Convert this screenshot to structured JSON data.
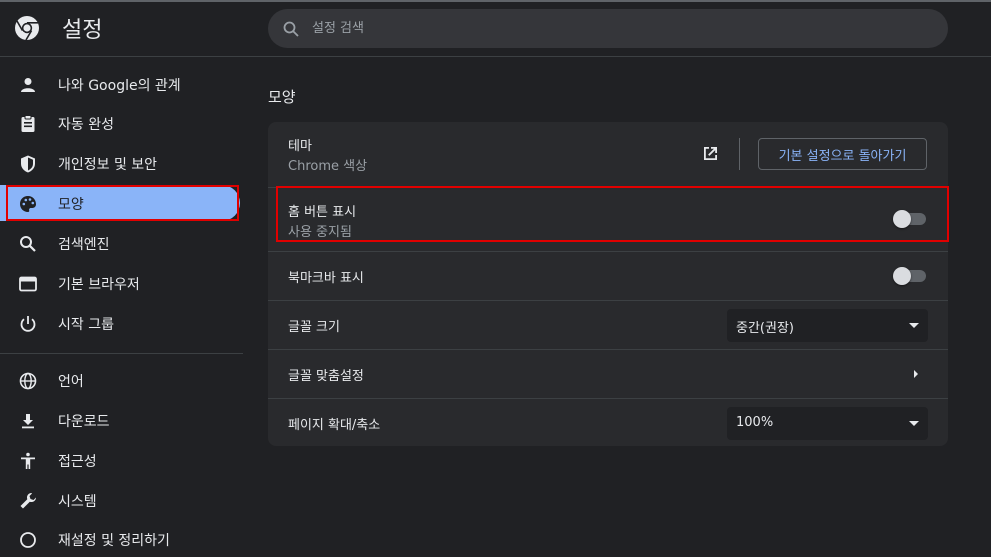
{
  "header": {
    "title": "설정",
    "search_placeholder": "설정 검색"
  },
  "sidebar": {
    "items": [
      {
        "label": "나와 Google의 관계",
        "icon": "person-icon"
      },
      {
        "label": "자동 완성",
        "icon": "clipboard-icon"
      },
      {
        "label": "개인정보 및 보안",
        "icon": "shield-icon"
      },
      {
        "label": "모양",
        "icon": "palette-icon"
      },
      {
        "label": "검색엔진",
        "icon": "search-icon"
      },
      {
        "label": "기본 브라우저",
        "icon": "browser-window-icon"
      },
      {
        "label": "시작 그룹",
        "icon": "power-icon"
      },
      {
        "label": "언어",
        "icon": "globe-icon"
      },
      {
        "label": "다운로드",
        "icon": "download-icon"
      },
      {
        "label": "접근성",
        "icon": "accessibility-icon"
      },
      {
        "label": "시스템",
        "icon": "wrench-icon"
      },
      {
        "label": "재설정 및 정리하기",
        "icon": "history-icon"
      }
    ],
    "active_index": 3
  },
  "main": {
    "section_title": "모양",
    "theme": {
      "label": "테마",
      "value": "Chrome 색상",
      "reset_label": "기본 설정으로 돌아가기"
    },
    "home_button": {
      "label": "홈 버튼 표시",
      "sublabel": "사용 중지됨",
      "enabled": false
    },
    "bookmarks_bar": {
      "label": "북마크바 표시",
      "enabled": false
    },
    "font_size": {
      "label": "글꼴 크기",
      "value": "중간(권장)"
    },
    "customize_fonts": {
      "label": "글꼴 맞춤설정"
    },
    "page_zoom": {
      "label": "페이지 확대/축소",
      "value": "100%"
    }
  },
  "colors": {
    "accent": "#8ab4f8",
    "background": "#202124",
    "card": "#292a2d",
    "highlight": "#e10000"
  }
}
